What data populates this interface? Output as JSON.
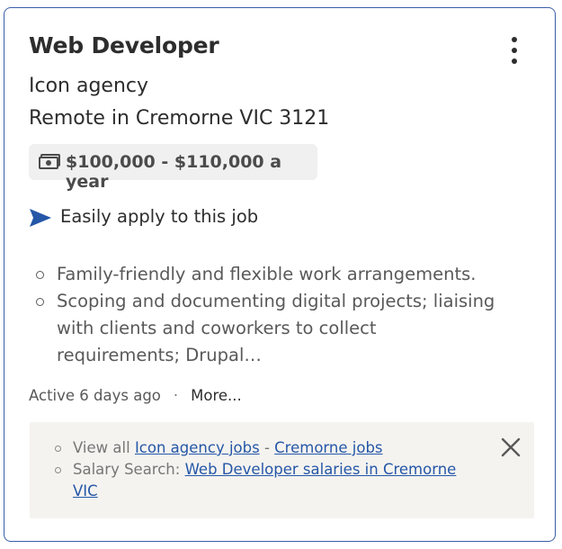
{
  "job": {
    "title": "Web Developer",
    "company": "Icon agency",
    "location": "Remote in Cremorne VIC 3121",
    "salary": "$100,000 - $110,000 a year",
    "easy_apply": "Easily apply to this job",
    "bullets": [
      "Family-friendly and flexible work arrangements.",
      "Scoping and documenting digital projects; liaising with clients and coworkers to collect requirements; Drupal…"
    ],
    "posted": "Active 6 days ago",
    "separator": "·",
    "more_label": "More..."
  },
  "related": {
    "view_all_prefix": "View all ",
    "company_jobs_link": "Icon agency jobs",
    "dash": " - ",
    "location_jobs_link": "Cremorne jobs",
    "salary_prefix": "Salary Search: ",
    "salary_link": "Web Developer salaries in Cremorne VIC"
  },
  "icons": {
    "menu": "kebab-menu-icon",
    "salary": "money-icon",
    "apply": "send-arrow-icon",
    "close": "close-icon"
  },
  "colors": {
    "border": "#3a5ea8",
    "link": "#2557a7",
    "apply_arrow": "#2557a7",
    "salary_bg": "#f0f0f0",
    "links_bg": "#f5f3f0"
  }
}
